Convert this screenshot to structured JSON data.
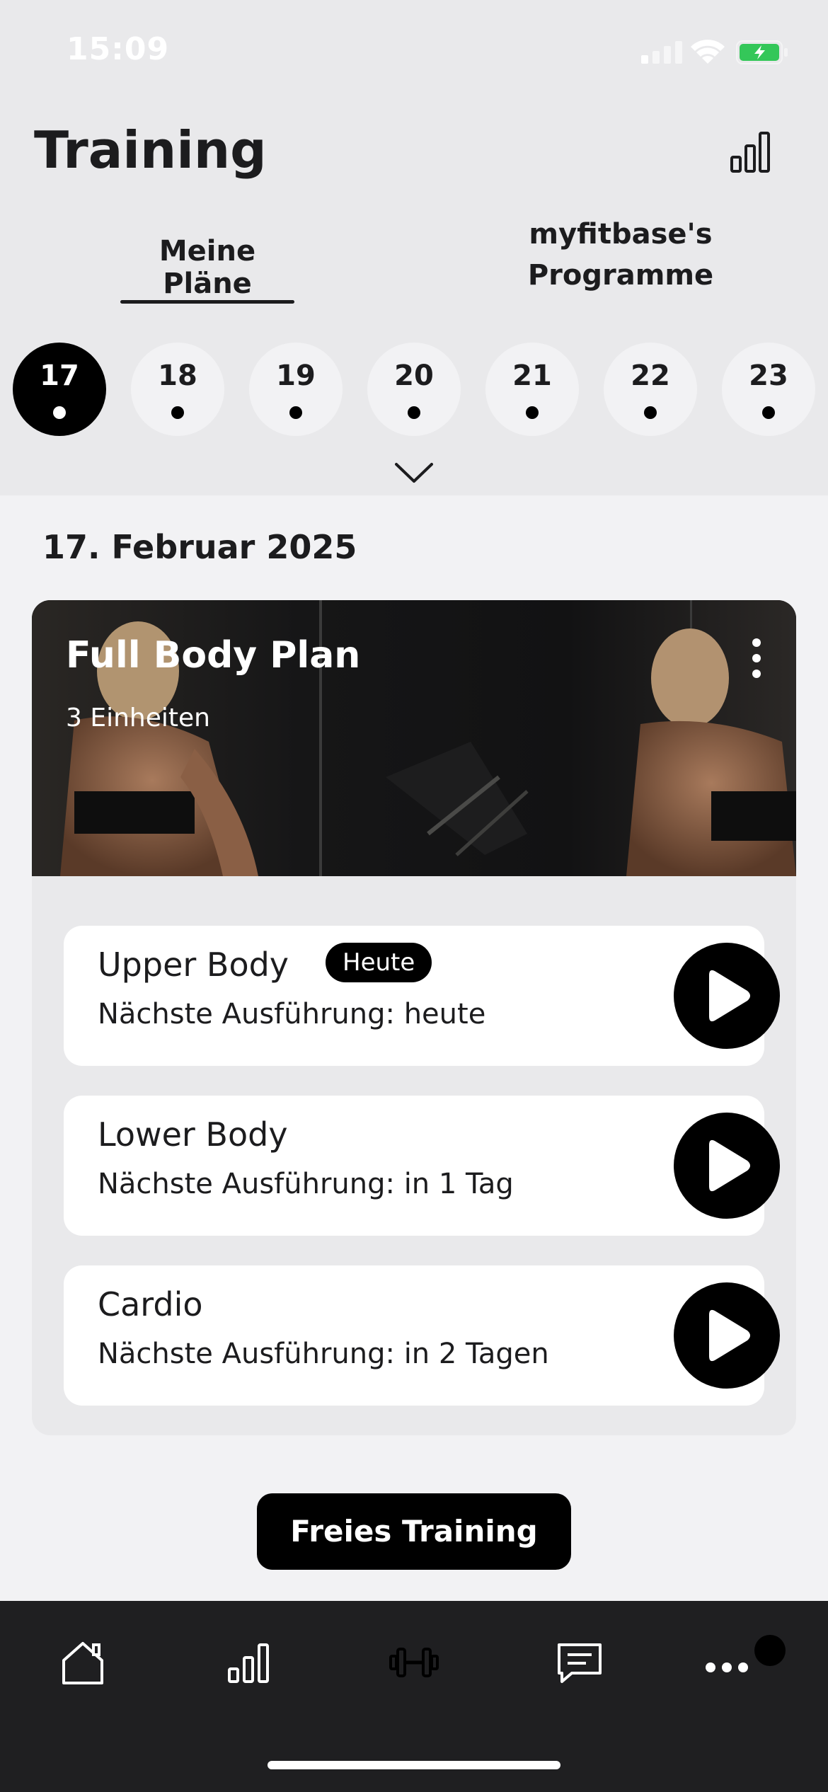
{
  "status_bar": {
    "time": "15:09"
  },
  "header": {
    "title": "Training"
  },
  "tabs": [
    {
      "label": "Meine Pläne",
      "active": true
    },
    {
      "label": "myfitbase's Programme",
      "active": false
    }
  ],
  "days": [
    {
      "num": "17",
      "selected": true
    },
    {
      "num": "18",
      "selected": false
    },
    {
      "num": "19",
      "selected": false
    },
    {
      "num": "20",
      "selected": false
    },
    {
      "num": "21",
      "selected": false
    },
    {
      "num": "22",
      "selected": false
    },
    {
      "num": "23",
      "selected": false
    }
  ],
  "date_label": "17. Februar 2025",
  "plan": {
    "title": "Full Body Plan",
    "subtitle": "3 Einheiten",
    "workouts": [
      {
        "name": "Upper Body",
        "badge": "Heute",
        "next": "Nächste Ausführung: heute"
      },
      {
        "name": "Lower Body",
        "next": "Nächste Ausführung: in 1 Tag"
      },
      {
        "name": "Cardio",
        "next": "Nächste Ausführung: in 2 Tagen"
      }
    ]
  },
  "free_training_label": "Freies Training",
  "bottom_nav": [
    "home-icon",
    "stats-icon",
    "dumbbell-icon",
    "chat-icon",
    "more-icon"
  ],
  "colors": {
    "accent": "#000000",
    "background": "#f2f2f4",
    "header_bg": "#e9e9eb",
    "nav_bg": "#1f1f21",
    "battery": "#34c759"
  }
}
